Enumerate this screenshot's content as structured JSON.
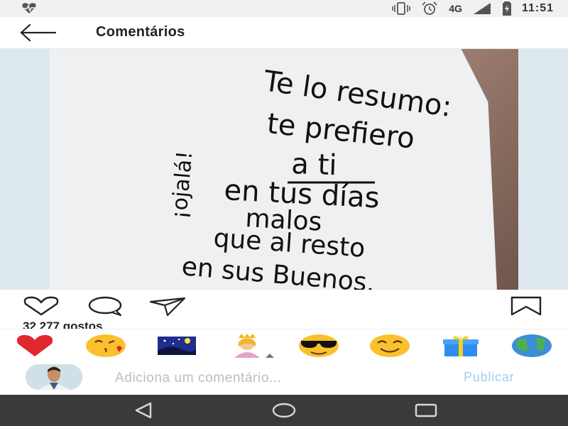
{
  "status_bar": {
    "network": "4G",
    "time": "11:51",
    "icons": [
      "heart-rate-icon",
      "vibrate-icon",
      "alarm-icon",
      "signal-icon",
      "battery-charging-icon"
    ]
  },
  "header": {
    "title": "Comentários",
    "back_icon": "arrow-left-icon"
  },
  "post": {
    "image_text_lines": [
      "Te lo resumo:",
      "te prefiero",
      "a ti",
      "en tus días",
      "malos",
      "que al resto",
      "en sus Buenos."
    ],
    "side_text": "¡ojalá!",
    "likes": "32 277 gostos"
  },
  "actions": [
    "heart-icon",
    "comment-icon",
    "share-icon",
    "bookmark-icon"
  ],
  "emoji_bar": [
    "heart",
    "kissing-face-wink",
    "starry-night",
    "princess",
    "sunglasses-face",
    "smiling-face",
    "gift",
    "globe"
  ],
  "comment": {
    "placeholder": "Adiciona um comentário...",
    "publish_label": "Publicar"
  },
  "nav_bar": [
    "back-triangle-icon",
    "home-circle-icon",
    "recents-square-icon"
  ],
  "colors": {
    "publish": "#9ed0ee",
    "heart_emoji": "#e0282e",
    "nav_bar": "#3a3a3a"
  }
}
